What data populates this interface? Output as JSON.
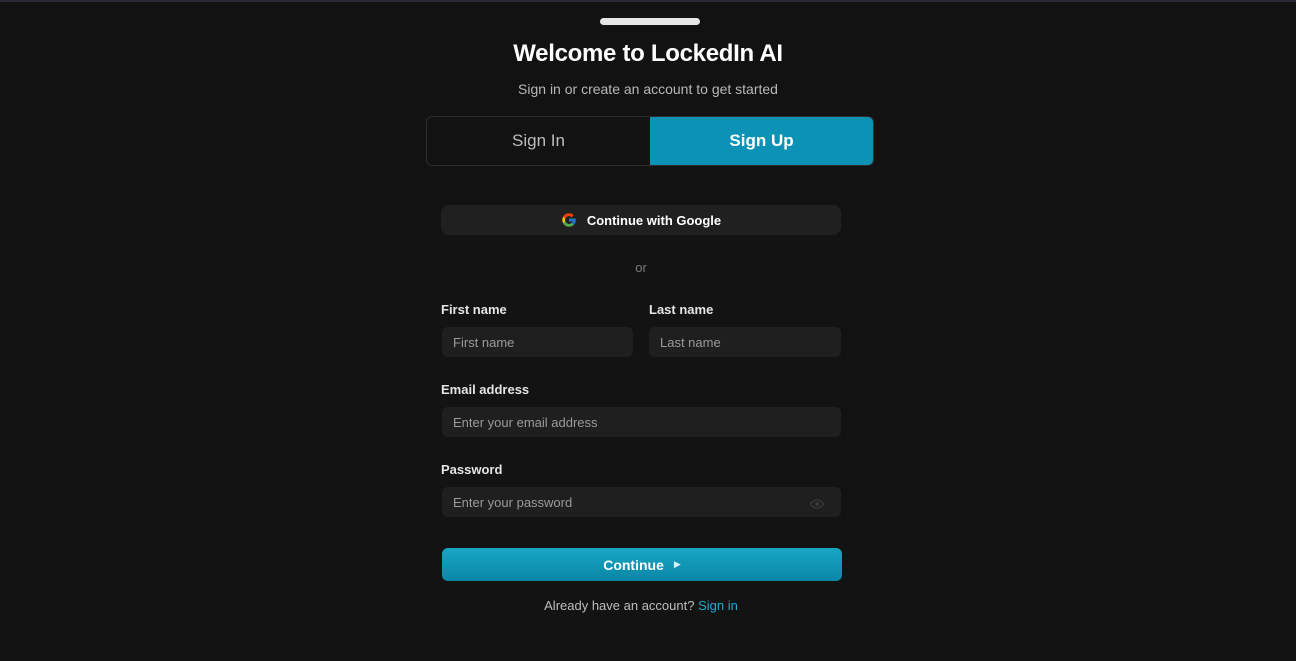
{
  "header": {
    "title": "Welcome to LockedIn AI",
    "subtitle": "Sign in or create an account to get started"
  },
  "tabs": [
    {
      "label": "Sign In",
      "active": false
    },
    {
      "label": "Sign Up",
      "active": true
    }
  ],
  "google_button": {
    "label": "Continue with Google",
    "icon": "google-icon"
  },
  "divider": {
    "text": "or"
  },
  "form": {
    "first_name": {
      "label": "First name",
      "placeholder": "First name",
      "value": ""
    },
    "last_name": {
      "label": "Last name",
      "placeholder": "Last name",
      "value": ""
    },
    "email": {
      "label": "Email address",
      "placeholder": "Enter your email address",
      "value": ""
    },
    "password": {
      "label": "Password",
      "placeholder": "Enter your password",
      "value": "",
      "toggle_icon": "eye-icon"
    }
  },
  "continue_button": {
    "label": "Continue",
    "icon": "play-arrow-icon"
  },
  "footer": {
    "text": "Already have an account?",
    "link": "Sign in"
  },
  "colors": {
    "accent": "#0c92b5",
    "link": "#22a9cf",
    "background": "#121212",
    "input_bg": "#1f1f20"
  }
}
